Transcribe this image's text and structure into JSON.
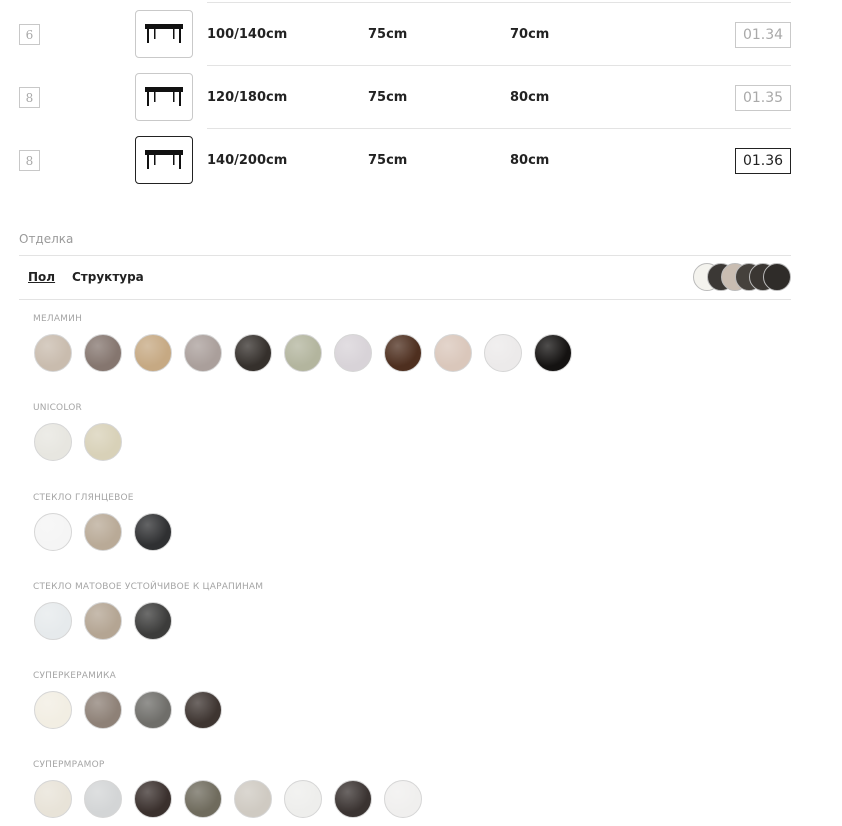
{
  "sizes": [
    {
      "seats": "6",
      "width": "100/140cm",
      "height": "75cm",
      "depth": "70cm",
      "code": "01.34",
      "selected": false
    },
    {
      "seats": "8",
      "width": "120/180cm",
      "height": "75cm",
      "depth": "80cm",
      "code": "01.35",
      "selected": false
    },
    {
      "seats": "8",
      "width": "140/200cm",
      "height": "75cm",
      "depth": "80cm",
      "code": "01.36",
      "selected": true
    }
  ],
  "finish": {
    "title": "Отделка",
    "tabs": [
      "Пол",
      "Структура"
    ],
    "active_tab": "Пол",
    "stack_colors": [
      "#f4f3ee",
      "#3b3835",
      "#c9bdb2",
      "#45413c",
      "#3a3632",
      "#2f2c29"
    ]
  },
  "groups": [
    {
      "label": "МЕЛАМИН",
      "swatches": [
        {
          "color": "#c9bcae",
          "icon": "melamine-beige"
        },
        {
          "color": "#85766f",
          "icon": "melamine-brown-grey"
        },
        {
          "color": "#c6a983",
          "icon": "melamine-oak"
        },
        {
          "color": "#aa9f9b",
          "icon": "melamine-taupe"
        },
        {
          "color": "#35302c",
          "icon": "melamine-dark"
        },
        {
          "color": "#b3b59e",
          "icon": "melamine-sage"
        },
        {
          "color": "#d8d3d8",
          "icon": "melamine-light-grey"
        },
        {
          "color": "#4e2f1f",
          "icon": "melamine-walnut"
        },
        {
          "color": "#dac7bb",
          "icon": "melamine-cream"
        },
        {
          "color": "#eceaea",
          "icon": "melamine-marble"
        },
        {
          "color": "#141211",
          "icon": "melamine-black-marble"
        }
      ]
    },
    {
      "label": "UNICOLOR",
      "swatches": [
        {
          "color": "#e7e6e0",
          "icon": "unicolor-white-stone"
        },
        {
          "color": "#d8d1b8",
          "icon": "unicolor-sand-stone"
        }
      ]
    },
    {
      "label": "СТЕКЛО ГЛЯНЦЕВОЕ",
      "swatches": [
        {
          "color": "#f5f5f5",
          "icon": "glass-gloss-white"
        },
        {
          "color": "#b9aa97",
          "icon": "glass-gloss-taupe"
        },
        {
          "color": "#2f3032",
          "icon": "glass-gloss-black"
        }
      ]
    },
    {
      "label": "СТЕКЛО МАТОВОЕ УСТОЙЧИВОЕ К ЦАРАПИНАМ",
      "swatches": [
        {
          "color": "#e6eaec",
          "icon": "glass-matt-white"
        },
        {
          "color": "#b4a593",
          "icon": "glass-matt-taupe"
        },
        {
          "color": "#3c3c3b",
          "icon": "glass-matt-anthracite"
        }
      ]
    },
    {
      "label": "СУПЕРКЕРАМИКА",
      "swatches": [
        {
          "color": "#f2eee3",
          "icon": "ceramic-ivory"
        },
        {
          "color": "#8e8177",
          "icon": "ceramic-taupe"
        },
        {
          "color": "#6f6e6a",
          "icon": "ceramic-grey"
        },
        {
          "color": "#3e3531",
          "icon": "ceramic-dark-brown"
        }
      ]
    },
    {
      "label": "СУПЕРМРАМОР",
      "swatches": [
        {
          "color": "#e8e3d8",
          "icon": "marble-cream"
        },
        {
          "color": "#d3d5d6",
          "icon": "marble-grey-vein"
        },
        {
          "color": "#3a302d",
          "icon": "marble-dark-brown"
        },
        {
          "color": "#6f6b5d",
          "icon": "marble-green"
        },
        {
          "color": "#cfcac2",
          "icon": "marble-breccia"
        },
        {
          "color": "#eeeeec",
          "icon": "marble-calacatta"
        },
        {
          "color": "#3a3331",
          "icon": "marble-emperador"
        },
        {
          "color": "#f0efee",
          "icon": "marble-statuario"
        }
      ]
    }
  ]
}
